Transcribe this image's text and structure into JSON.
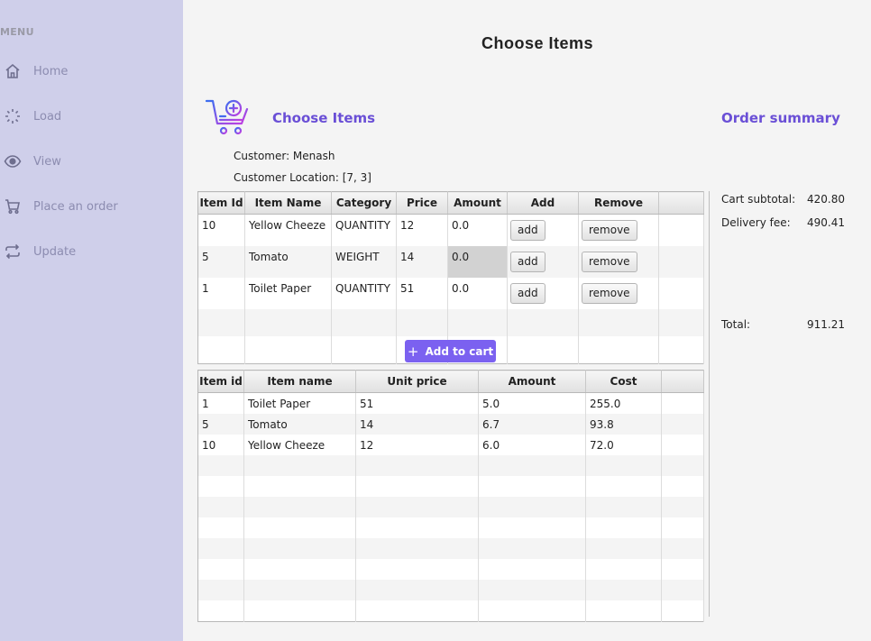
{
  "sidebar": {
    "menu_title": "MENU",
    "items": [
      {
        "label": "Home",
        "icon": "home-icon"
      },
      {
        "label": "Load",
        "icon": "loader-icon"
      },
      {
        "label": "View",
        "icon": "eye-icon"
      },
      {
        "label": "Place an order",
        "icon": "cart-icon"
      },
      {
        "label": "Update",
        "icon": "refresh-icon"
      }
    ]
  },
  "main": {
    "page_title": "Choose Items",
    "section_title": "Choose Items",
    "customer_line": "Customer: Menash",
    "location_line": "Customer Location: [7, 3]",
    "add_to_cart_label": "Add to cart"
  },
  "items_table": {
    "headers": [
      "Item Id",
      "Item Name",
      "Category",
      "Price",
      "Amount",
      "Add",
      "Remove"
    ],
    "add_label": "add",
    "remove_label": "remove",
    "rows": [
      {
        "id": "10",
        "name": "Yellow Cheeze",
        "category": "QUANTITY",
        "price": "12",
        "amount": "0.0"
      },
      {
        "id": "5",
        "name": "Tomato",
        "category": "WEIGHT",
        "price": "14",
        "amount": "0.0"
      },
      {
        "id": "1",
        "name": "Toilet Paper",
        "category": "QUANTITY",
        "price": "51",
        "amount": "0.0"
      }
    ]
  },
  "cart_table": {
    "headers": [
      "Item id",
      "Item name",
      "Unit price",
      "Amount",
      "Cost"
    ],
    "rows": [
      {
        "id": "1",
        "name": "Toilet Paper",
        "unit_price": "51",
        "amount": "5.0",
        "cost": "255.0"
      },
      {
        "id": "5",
        "name": "Tomato",
        "unit_price": "14",
        "amount": "6.7",
        "cost": "93.8"
      },
      {
        "id": "10",
        "name": "Yellow Cheeze",
        "unit_price": "12",
        "amount": "6.0",
        "cost": "72.0"
      }
    ]
  },
  "order_summary": {
    "title": "Order summary",
    "cart_subtotal_label": "Cart subtotal:",
    "cart_subtotal_value": "420.80",
    "delivery_fee_label": "Delivery fee:",
    "delivery_fee_value": "490.41",
    "total_label": "Total:",
    "total_value": "911.21"
  },
  "colors": {
    "sidebar_bg": "#cfcfea",
    "accent": "#6a4fd6",
    "button_primary": "#7b61f0",
    "page_bg": "#f4f4f4"
  }
}
